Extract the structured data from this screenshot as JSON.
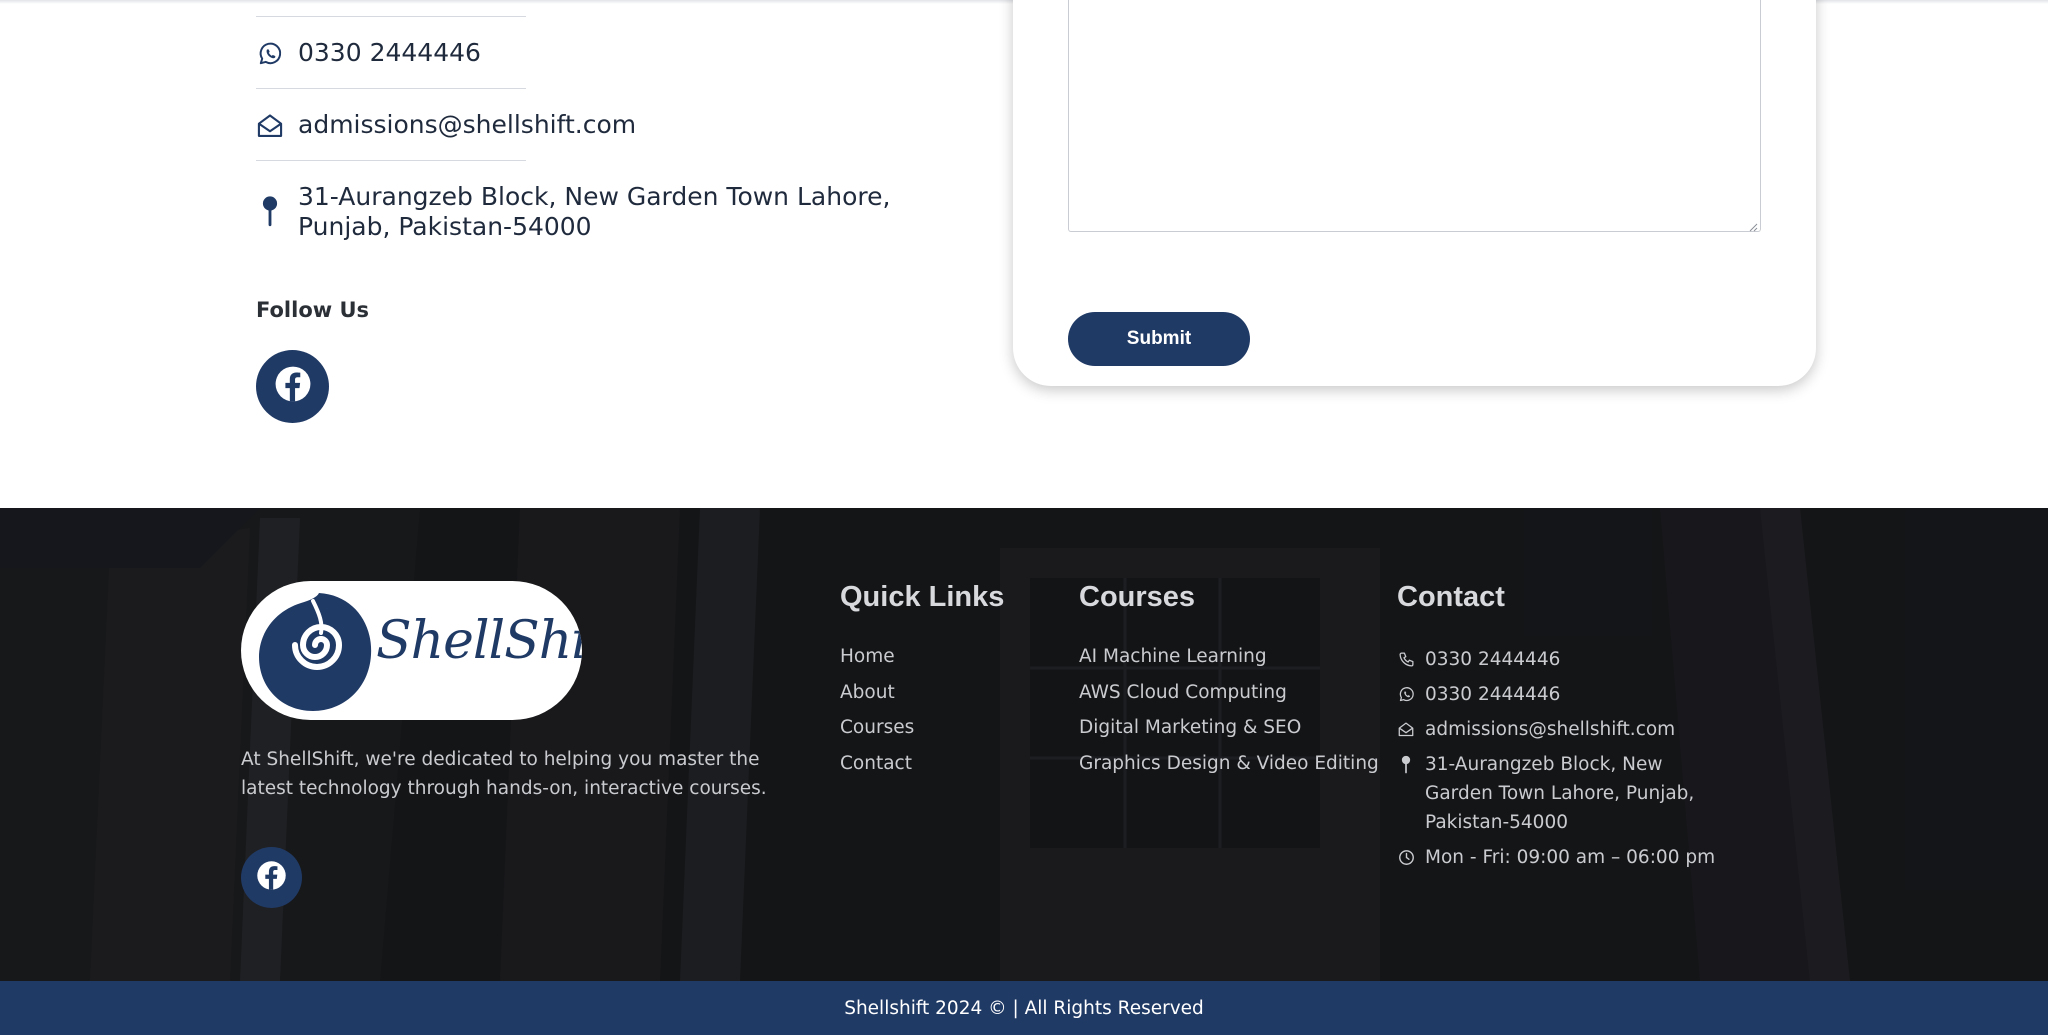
{
  "contact_info": {
    "whatsapp": "0330 2444446",
    "email": "admissions@shellshift.com",
    "address": "31-Aurangzeb Block, New Garden Town Lahore, Punjab, Pakistan-54000"
  },
  "follow": {
    "title": "Follow Us"
  },
  "form": {
    "submit_label": "Submit"
  },
  "footer": {
    "logo_text": "ShellShift",
    "description": "At ShellShift, we're dedicated to helping you master the latest technology through hands-on, interactive courses.",
    "quick_links": {
      "title": "Quick Links",
      "items": [
        "Home",
        "About",
        "Courses",
        "Contact"
      ]
    },
    "courses": {
      "title": "Courses",
      "items": [
        "AI Machine Learning",
        "AWS Cloud Computing",
        "Digital Marketing & SEO",
        "Graphics Design & Video Editing"
      ]
    },
    "contact": {
      "title": "Contact",
      "phone": "0330 2444446",
      "whatsapp": "0330 2444446",
      "email": "admissions@shellshift.com",
      "address": "31-Aurangzeb Block, New Garden Town Lahore, Punjab, Pakistan-54000",
      "hours": "Mon - Fri: 09:00 am – 06:00 pm"
    },
    "copyright": "Shellshift 2024 © | All Rights Reserved"
  },
  "icons": {
    "whatsapp": "whatsapp-icon",
    "email": "envelope-open-icon",
    "address": "map-pin-icon",
    "facebook": "facebook-icon",
    "phone": "phone-icon",
    "clock": "clock-icon"
  },
  "colors": {
    "brand_navy": "#203a66",
    "footer_bg": "#1a1b1d",
    "text_dark": "#1f2a3d"
  }
}
